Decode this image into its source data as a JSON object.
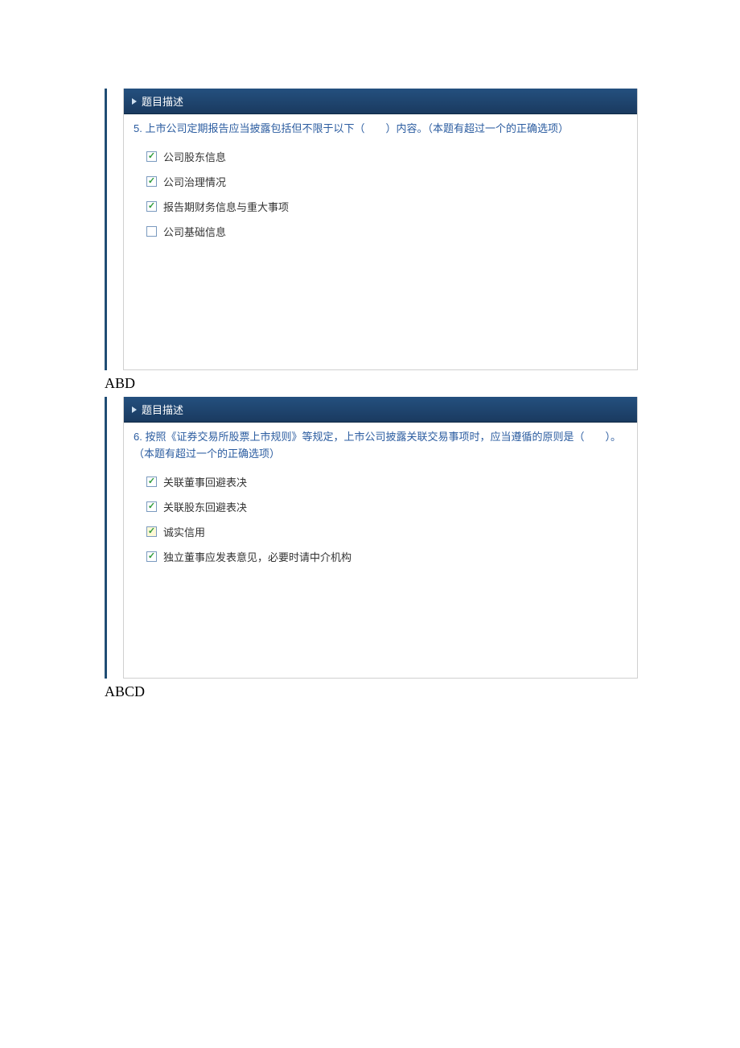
{
  "header_label": "题目描述",
  "q1": {
    "number": "5.",
    "text": "上市公司定期报告应当披露包括但不限于以下（　　）内容。（本题有超过一个的正确选项）",
    "options": [
      {
        "label": "公司股东信息",
        "checked": true,
        "yellow": false
      },
      {
        "label": "公司治理情况",
        "checked": true,
        "yellow": false
      },
      {
        "label": "报告期财务信息与重大事项",
        "checked": true,
        "yellow": false
      },
      {
        "label": "公司基础信息",
        "checked": false,
        "yellow": false
      }
    ],
    "answer": "ABD"
  },
  "q2": {
    "number": "6.",
    "text": "按照《证券交易所股票上市规则》等规定，上市公司披露关联交易事项时，应当遵循的原则是（　　）。（本题有超过一个的正确选项）",
    "options": [
      {
        "label": "关联董事回避表决",
        "checked": true,
        "yellow": false
      },
      {
        "label": "关联股东回避表决",
        "checked": true,
        "yellow": false
      },
      {
        "label": "诚实信用",
        "checked": true,
        "yellow": true
      },
      {
        "label": "独立董事应发表意见，必要时请中介机构",
        "checked": true,
        "yellow": false
      }
    ],
    "answer": "ABCD"
  }
}
